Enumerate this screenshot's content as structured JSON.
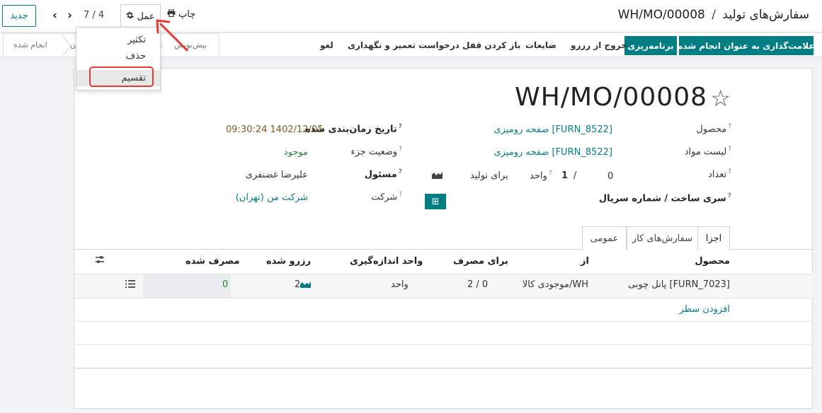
{
  "header": {
    "breadcrumb_parent": "سفارش‌های تولید",
    "breadcrumb_separator": "/",
    "breadcrumb_current": "WH/MO/00008",
    "new_button": "جدید",
    "pager": "7 / 4",
    "action_label": "عمل",
    "print_label": "چاپ"
  },
  "action_menu": {
    "items": [
      "تکثیر",
      "حذف",
      "تقسیم"
    ],
    "highlighted": "تقسیم"
  },
  "toolbar": {
    "mark_done": "علامت‌گذاری به عنوان انجام شده",
    "plan": "برنامه‌ریزی",
    "unreserve": "خروج از رزرو",
    "scrap": "ضایعات",
    "unlock": "باز کردن قفل",
    "maintenance": "درخواست تعمیر و نگهداری",
    "cancel": "لغو"
  },
  "statusbar": {
    "stages": [
      "انجام شده",
      "ن",
      "پیش‌نویس"
    ]
  },
  "record": {
    "title": "WH/MO/00008",
    "fields_right": {
      "product_label": "محصول",
      "product_value": "[FURN_8522] صفحه رومیزی",
      "bom_label": "لیست مواد",
      "bom_value": "[FURN_8522] صفحه رومیزی",
      "qty_label": "تعداد",
      "qty_value": "0",
      "qty_sep": "/",
      "qty_target": "1",
      "qty_unit": "واحد",
      "to_produce": "برای تولید",
      "lot_label": "سری ساخت / شماره سریال"
    },
    "fields_left": {
      "scheduled_label": "تاریخ زمان‌بندی شده",
      "scheduled_value": "1402/12/05 09:30:24",
      "component_status_label": "وضعیت جزء",
      "component_status_value": "موجود",
      "responsible_label": "مسئول",
      "responsible_value": "علیرضا غضنفری",
      "company_label": "شرکت",
      "company_value": "شرکت من (تهران)"
    }
  },
  "tabs": [
    {
      "label": "اجزا",
      "active": true
    },
    {
      "label": "سفارش‌های کار",
      "active": false
    },
    {
      "label": "عمومی",
      "active": false
    }
  ],
  "table": {
    "headers": {
      "product": "محصول",
      "from": "از",
      "to_consume": "برای مصرف",
      "uom": "واحد اندازه‌گیری",
      "reserved": "رزرو شده",
      "consumed": "مصرف شده"
    },
    "rows": [
      {
        "product": "[FURN_7023] پانل چوبی",
        "from": "WH/موجودی کالا",
        "to_consume": "2 / 0",
        "uom": "واحد",
        "reserved": "2",
        "consumed": "0"
      }
    ],
    "add_line": "افزودن سطر"
  },
  "colors": {
    "primary": "#017e84",
    "highlight_box": "#e53935"
  }
}
